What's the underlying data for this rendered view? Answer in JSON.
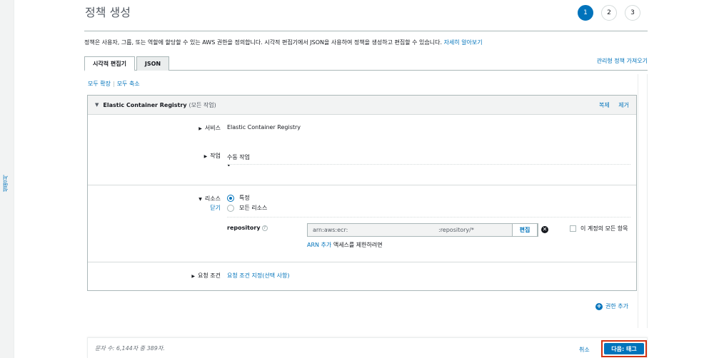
{
  "rail": {
    "label": "설명서"
  },
  "page": {
    "title": "정책 생성"
  },
  "steps": [
    "1",
    "2",
    "3"
  ],
  "description": {
    "text": "정책은 사용자, 그룹, 또는 역할에 할당할 수 있는 AWS 권한을 정의합니다. 시각적 편집기에서 JSON을 사용하여 정책을 생성하고 편집할 수 있습니다.",
    "link": "자세히 알아보기"
  },
  "tabs": {
    "visual": "시각적 편집기",
    "json": "JSON"
  },
  "import_link": "관리형 정책 가져오기",
  "expand": {
    "expand_all": "모두 확장",
    "collapse_all": "모두 축소"
  },
  "service_block": {
    "name": "Elastic Container Registry",
    "suffix": "(모든 작업)",
    "clone": "복제",
    "remove": "제거",
    "service_label": "서비스",
    "service_value": "Elastic Container Registry",
    "actions_label": "작업",
    "actions_value": "수동 작업",
    "actions_bullet": "•",
    "resources_label": "리소스",
    "close_link": "닫기",
    "radio_specific": "특정",
    "radio_all": "모든 리소스",
    "repository_label": "repository",
    "help_glyph": "?",
    "arn_part1": "arn:aws:ecr:",
    "arn_part2": ":repository/*",
    "edit_button": "편집",
    "remove_glyph": "✕",
    "checkbox_label": "이 계정의 모든 항목",
    "add_arn_link": "ARN 추가",
    "add_arn_suffix": "액세스를 제한하려면",
    "conditions_label": "요청 조건",
    "conditions_link": "요청 조건 지정(선택 사항)"
  },
  "add_permission": {
    "icon": "+",
    "label": "권한 추가"
  },
  "footer": {
    "char_count": "문자 수: 6,144자 중 389자.",
    "cancel": "취소",
    "next": "다음: 태그"
  }
}
